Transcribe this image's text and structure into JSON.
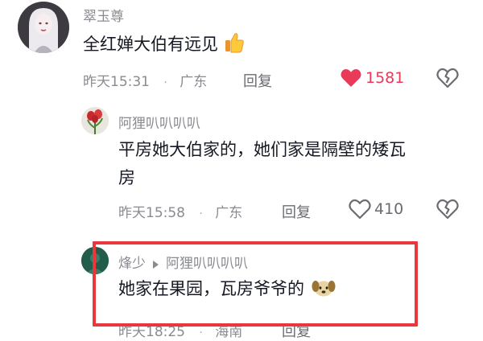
{
  "comments": [
    {
      "username": "翠玉尊",
      "text": "全红婵大伯有远见",
      "emoji": "thumbs-up-emoji",
      "time": "昨天15:31",
      "location": "广东",
      "reply_label": "回复",
      "likes": "1581",
      "liked": true
    },
    {
      "username": "阿狸叭叭叭叭",
      "text_line1": "平房她大伯家的，她们家是隔壁的矮瓦",
      "text_line2": "房",
      "time": "昨天15:58",
      "location": "广东",
      "reply_label": "回复",
      "likes": "410",
      "liked": false
    },
    {
      "username": "烽少",
      "reply_to": "阿狸叭叭叭叭",
      "text": "她家在果园，瓦房爷爷的",
      "emoji": "dog-face-emoji",
      "time": "昨天18:25",
      "location": "海南",
      "reply_label": "回复"
    }
  ],
  "colors": {
    "like_active": "#ea3a5a",
    "highlight_border": "#e9373d",
    "meta_text": "#8a8b91"
  }
}
